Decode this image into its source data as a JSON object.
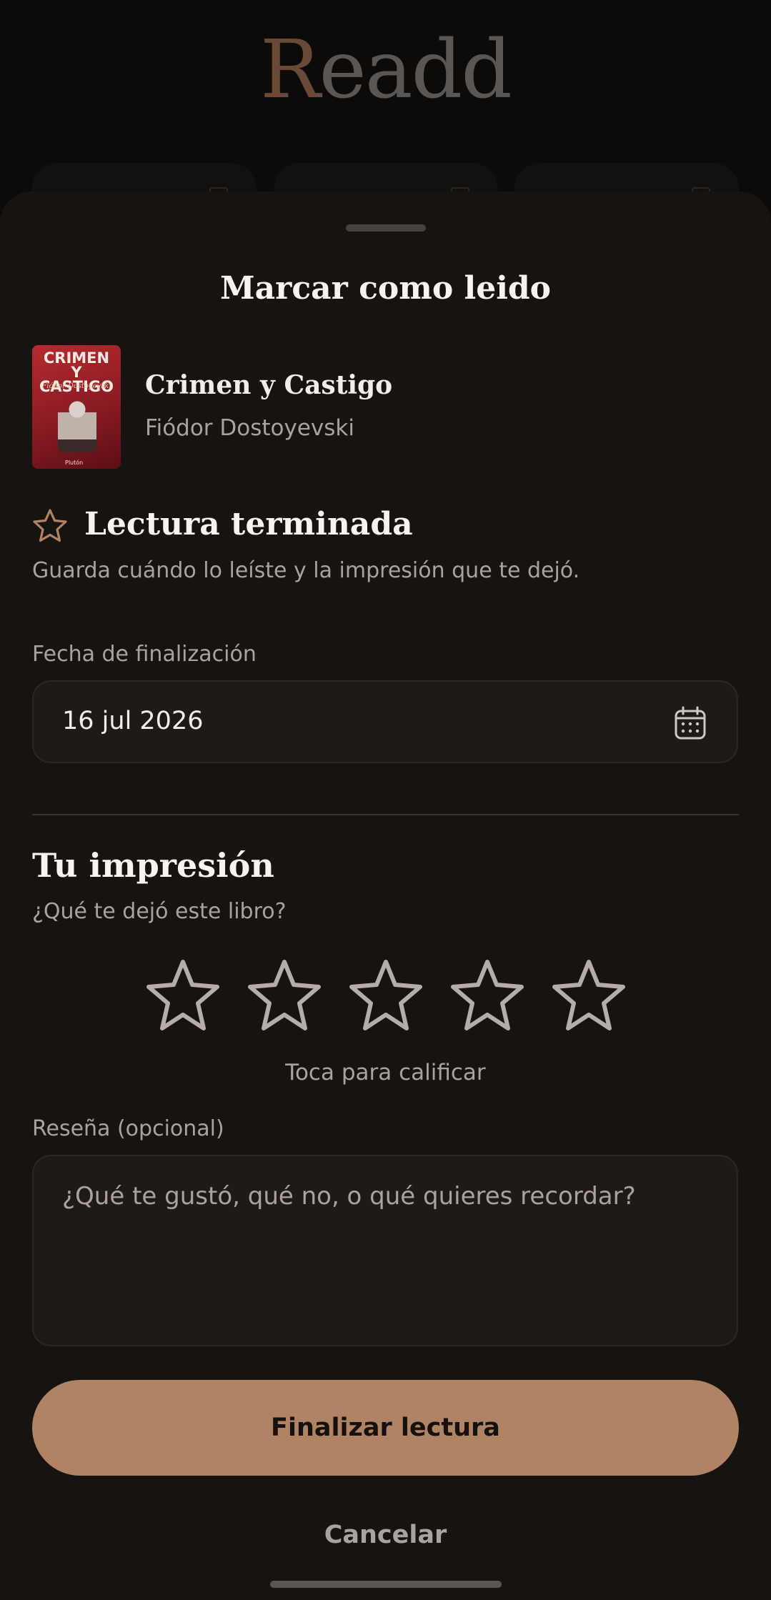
{
  "app": {
    "logo_first": "R",
    "logo_rest": "eadd"
  },
  "sheet": {
    "title": "Marcar como leido",
    "book": {
      "title": "Crimen y Castigo",
      "author": "Fiódor Dostoyevski",
      "cover": {
        "title": "CRIMEN Y CASTIGO",
        "author": "Fiódor Dostoyevski",
        "publisher": "Plutón"
      }
    },
    "finished": {
      "title": "Lectura terminada",
      "description": "Guarda cuándo lo leíste y la impresión que te dejó."
    },
    "date_field": {
      "label": "Fecha de finalización",
      "value": "16 jul 2026"
    },
    "impression": {
      "title": "Tu impresión",
      "subtitle": "¿Qué te dejó este libro?",
      "rating": 0,
      "max_rating": 5,
      "hint": "Toca para calificar"
    },
    "review": {
      "label": "Reseña (opcional)",
      "placeholder": "¿Qué te gustó, qué no, o qué quieres recordar?",
      "value": ""
    },
    "primary_button": "Finalizar lectura",
    "cancel_button": "Cancelar"
  },
  "colors": {
    "background": "#161311",
    "accent": "#b08364",
    "text_primary": "#f2ede8",
    "text_secondary": "#aaa39d",
    "field_bg": "#1f1a17",
    "star_outline": "#b5aea8"
  },
  "icons": [
    "star-outline-icon",
    "calendar-icon"
  ]
}
